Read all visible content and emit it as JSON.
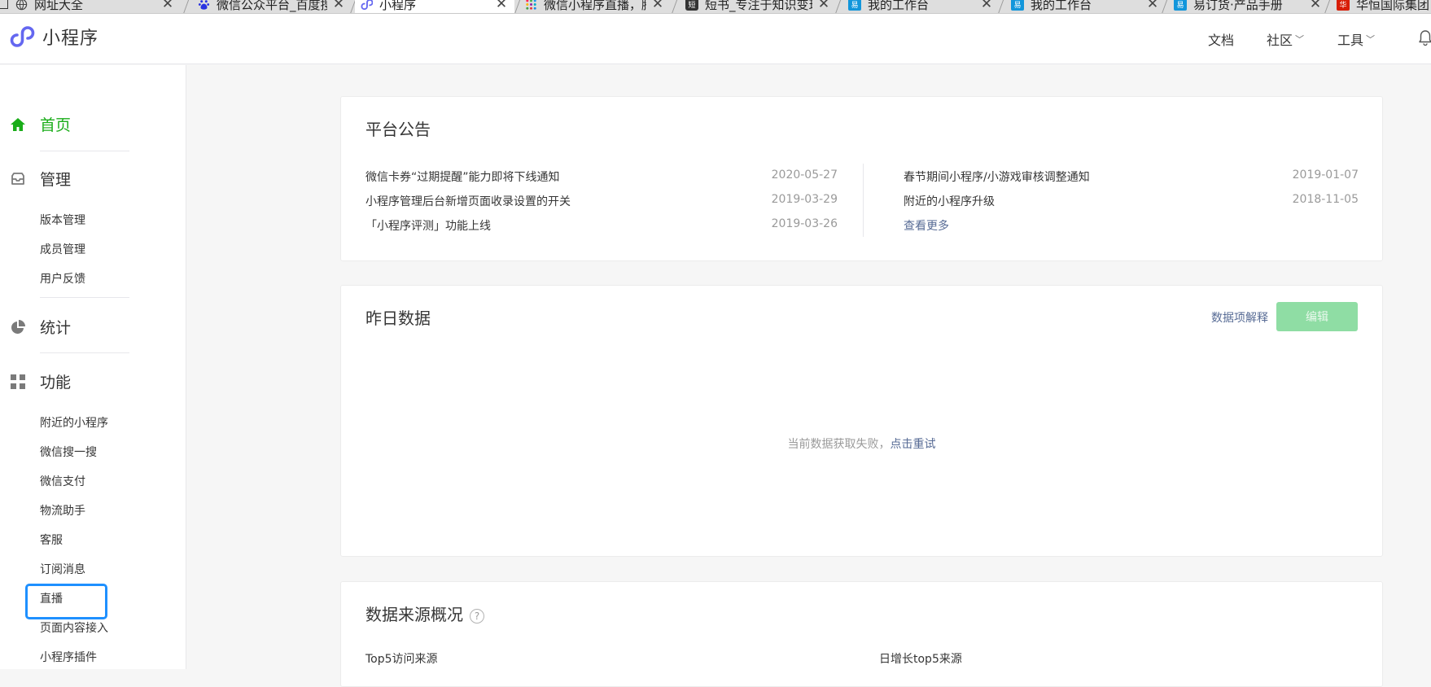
{
  "browser": {
    "tabs": [
      {
        "label": "网址大全",
        "icon": "globe-icon",
        "active": false
      },
      {
        "label": "微信公众平台_百度搜",
        "icon": "baidu-icon",
        "active": false
      },
      {
        "label": "小程序",
        "icon": "miniprogram-icon",
        "active": true
      },
      {
        "label": "微信小程序直播，腾讯",
        "icon": "dots-icon",
        "active": false
      },
      {
        "label": "短书_专注于知识变现",
        "icon": "duanshu-icon",
        "active": false
      },
      {
        "label": "我的工作台",
        "icon": "workbench-icon",
        "active": false
      },
      {
        "label": "我的工作台",
        "icon": "workbench-icon",
        "active": false
      },
      {
        "label": "易订货·产品手册",
        "icon": "workbench-icon",
        "active": false
      },
      {
        "label": "华恒国际集团",
        "icon": "red-logo-icon",
        "active": false
      }
    ]
  },
  "header": {
    "brand": "小程序",
    "nav": {
      "docs": "文档",
      "community": "社区",
      "tools": "工具"
    }
  },
  "sidebar": {
    "home": "首页",
    "manage": "管理",
    "manage_items": [
      "版本管理",
      "成员管理",
      "用户反馈"
    ],
    "stats": "统计",
    "features": "功能",
    "feature_items": [
      "附近的小程序",
      "微信搜一搜",
      "微信支付",
      "物流助手",
      "客服",
      "订阅消息",
      "直播",
      "页面内容接入",
      "小程序插件"
    ]
  },
  "announcements": {
    "title": "平台公告",
    "left": [
      {
        "text": "微信卡券“过期提醒”能力即将下线通知",
        "date": "2020-05-27"
      },
      {
        "text": "小程序管理后台新增页面收录设置的开关",
        "date": "2019-03-29"
      },
      {
        "text": "「小程序评测」功能上线",
        "date": "2019-03-26"
      }
    ],
    "right": [
      {
        "text": "春节期间小程序/小游戏审核调整通知",
        "date": "2019-01-07"
      },
      {
        "text": "附近的小程序升级",
        "date": "2018-11-05"
      }
    ],
    "more": "查看更多"
  },
  "yesterday": {
    "title": "昨日数据",
    "explain_link": "数据项解释",
    "edit_button": "编辑",
    "error_text": "当前数据获取失败，",
    "retry_link": "点击重试"
  },
  "sources": {
    "title": "数据来源概况",
    "help": "?",
    "top5": "Top5访问来源",
    "growth": "日增长top5来源"
  },
  "colors": {
    "accent": "#1aad19",
    "link": "#576b95",
    "highlight": "#1e90ff"
  }
}
